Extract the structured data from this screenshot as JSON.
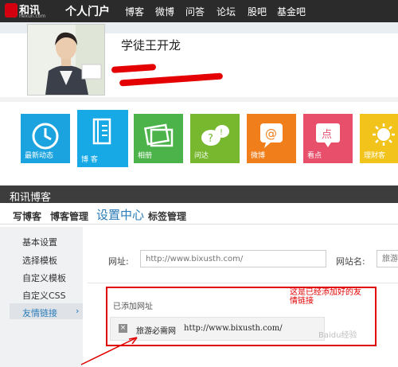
{
  "topnav": {
    "logo_text": "和讯",
    "logo_sub": "hexun.com",
    "portal": "个人门户",
    "items": [
      "博客",
      "微博",
      "问答",
      "论坛",
      "股吧",
      "基金吧"
    ]
  },
  "profile": {
    "username": "学徒王开龙"
  },
  "apps": [
    {
      "label": "最新动态",
      "color": "#1aa3df",
      "icon": "clock-icon"
    },
    {
      "label": "博 客",
      "color": "#17a9e6",
      "icon": "book-icon"
    },
    {
      "label": "相册",
      "color": "#4bb34a",
      "icon": "photo-icon"
    },
    {
      "label": "问达",
      "color": "#77b82f",
      "icon": "question-icon"
    },
    {
      "label": "微博",
      "color": "#f07f1b",
      "icon": "at-icon"
    },
    {
      "label": "看点",
      "color": "#e84f6b",
      "icon": "point-icon"
    },
    {
      "label": "理财客",
      "color": "#f2c31a",
      "icon": "sun-icon"
    }
  ],
  "blog": {
    "title": "和讯博客",
    "tabs": [
      "写博客",
      "博客管理",
      "设置中心",
      "标签管理"
    ],
    "active_tab": "设置中心"
  },
  "sidebar": {
    "items": [
      "基本设置",
      "选择模板",
      "自定义模板",
      "自定义CSS",
      "友情链接"
    ],
    "active": "友情链接"
  },
  "form": {
    "url_label": "网址:",
    "url_placeholder": "http://www.bixusth.com/",
    "name_label": "网站名:",
    "name_placeholder": "旅游",
    "added_label": "已添加网址",
    "link": {
      "name": "旅游必需网",
      "url": "http://www.bixusth.com/"
    }
  },
  "annotation": {
    "note": "这是已经添加好的友情链接"
  },
  "watermark": "Baidu经验"
}
